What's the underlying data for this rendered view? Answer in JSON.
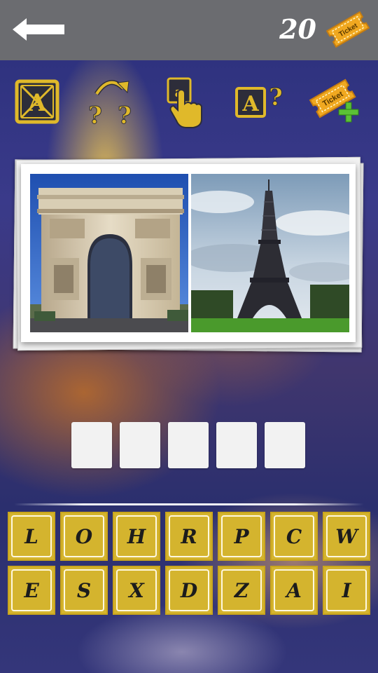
{
  "header": {
    "back_icon": "back-arrow-icon",
    "ticket_count": "20",
    "ticket_icon_label": "Ticket"
  },
  "toolbar": {
    "tools": [
      {
        "name": "remove-letters-tool",
        "icon": "crossed-letter-icon"
      },
      {
        "name": "skip-puzzle-tool",
        "icon": "question-marks-arrow-icon"
      },
      {
        "name": "reveal-letter-tool",
        "icon": "tap-hand-icon"
      },
      {
        "name": "hint-letter-tool",
        "icon": "letter-question-icon"
      },
      {
        "name": "buy-tickets-tool",
        "icon": "ticket-plus-icon",
        "label": "Ticket"
      }
    ]
  },
  "puzzle": {
    "photos": [
      {
        "icon": "arc-de-triomphe-photo"
      },
      {
        "icon": "eiffel-tower-photo"
      }
    ],
    "answer_slots": [
      "",
      "",
      "",
      "",
      ""
    ]
  },
  "keyboard": {
    "rows": [
      [
        "L",
        "O",
        "H",
        "R",
        "P",
        "C",
        "W"
      ],
      [
        "E",
        "S",
        "X",
        "D",
        "Z",
        "A",
        "I"
      ]
    ]
  },
  "colors": {
    "top_bar": "#6b6c70",
    "key_gold": "#d4b42e",
    "icon_gold": "#e0b92a",
    "ticket_orange": "#f0a820",
    "plus_green": "#5bc236",
    "slot_white": "#f2f2f2"
  }
}
